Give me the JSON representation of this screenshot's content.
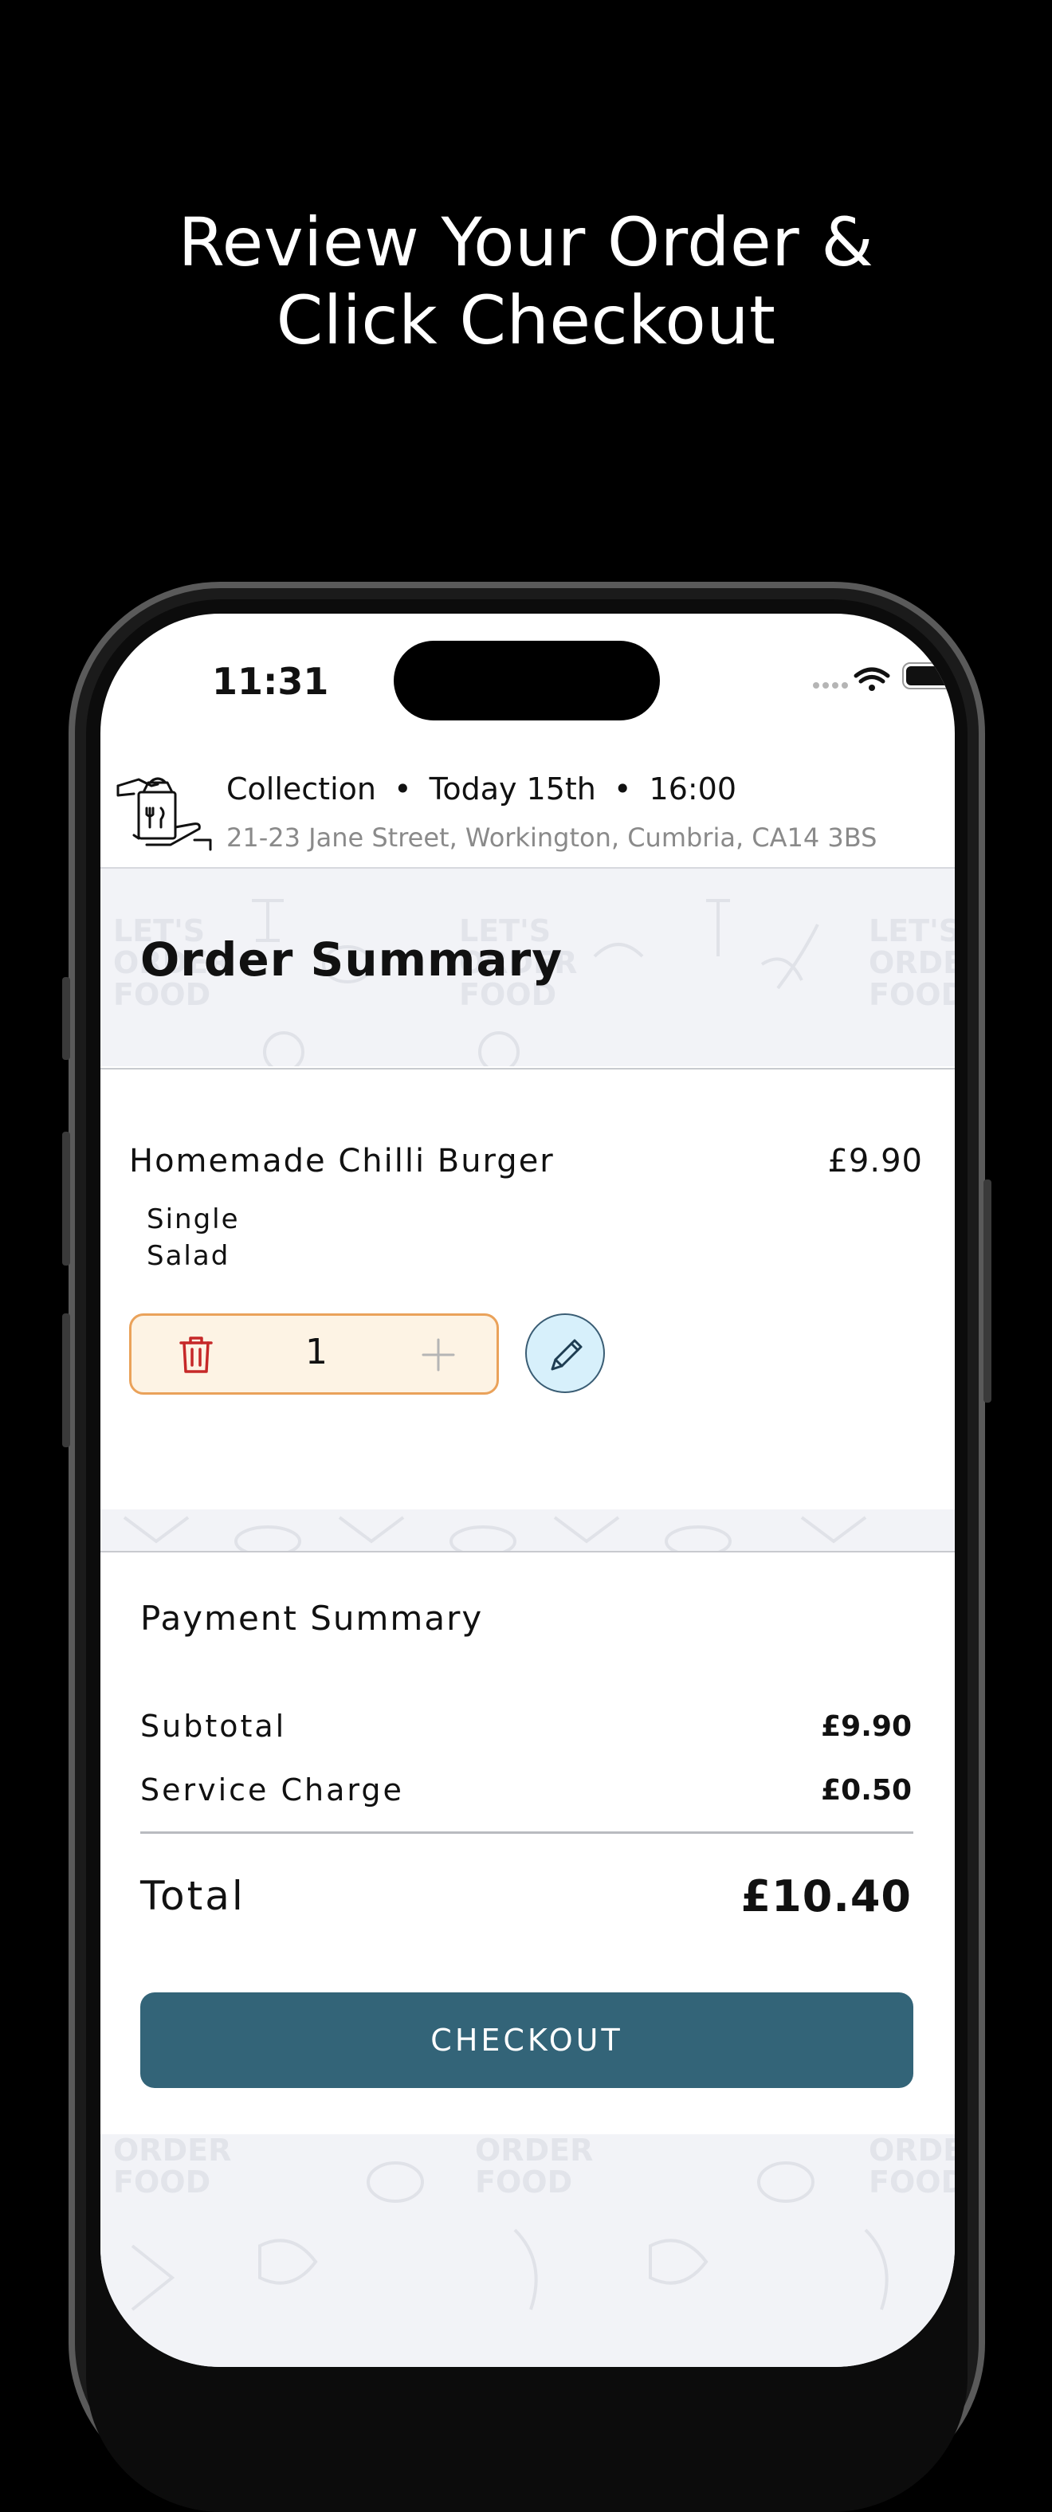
{
  "headline": {
    "line1": "Review Your Order &",
    "line2": "Click Checkout"
  },
  "status_bar": {
    "time": "11:31",
    "icons": [
      "signal-dots-icon",
      "wifi-icon",
      "battery-icon"
    ]
  },
  "collection": {
    "icon": "takeaway-bag-hands-icon",
    "mode": "Collection",
    "day": "Today 15th",
    "time": "16:00",
    "separator": "•",
    "address": "21-23 Jane Street, Workington, Cumbria, CA14  3BS"
  },
  "order_summary": {
    "title": "Order Summary",
    "items": [
      {
        "name": "Homemade Chilli Burger",
        "price": "£9.90",
        "options": [
          "Single",
          "Salad"
        ],
        "quantity": "1"
      }
    ]
  },
  "background_pattern_text": "LET'S ORDER FOOD",
  "payment_summary": {
    "title": "Payment Summary",
    "subtotal_label": "Subtotal",
    "subtotal_value": "£9.90",
    "service_label": "Service Charge",
    "service_value": "£0.50",
    "total_label": "Total",
    "total_value": "£10.40",
    "checkout_label": "CHECKOUT"
  },
  "colors": {
    "checkout": "#336478",
    "stepper_border": "#eaa25a",
    "stepper_bg": "#fdf3e4",
    "trash": "#c62828",
    "edit_bg": "#d7f0fb",
    "pattern_bg": "#f2f3f7"
  }
}
